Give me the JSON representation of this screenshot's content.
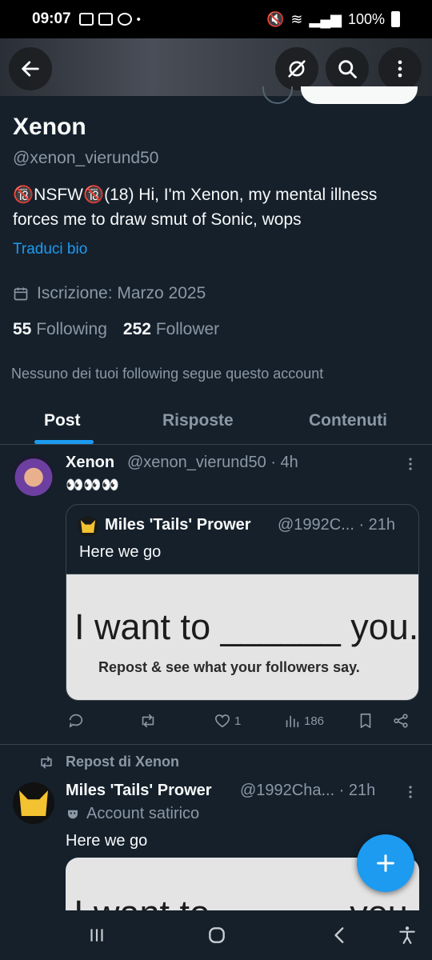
{
  "status_bar": {
    "time": "09:07",
    "battery": "100%"
  },
  "profile": {
    "name": "Xenon",
    "handle": "@xenon_vierund50",
    "bio": "🔞NSFW🔞(18) Hi, I'm Xenon, my mental illness forces me to draw smut of Sonic, wops",
    "translate_label": "Traduci bio",
    "joined": "Iscrizione: Marzo 2025",
    "following_count": "55",
    "following_label": "Following",
    "followers_count": "252",
    "followers_label": "Follower",
    "not_followed_note": "Nessuno dei tuoi following segue questo account"
  },
  "tabs": [
    {
      "label": "Post",
      "active": true
    },
    {
      "label": "Risposte",
      "active": false
    },
    {
      "label": "Contenuti",
      "active": false
    }
  ],
  "tweet1": {
    "name": "Xenon",
    "meta": "@xenon_vierund50 · 4h",
    "text": "👀👀👀",
    "quote": {
      "name": "Miles 'Tails' Prower",
      "meta": "@1992C... · 21h",
      "text": "Here we go",
      "image_main": "I want to ______ you.",
      "image_sub": "Repost & see what your followers say."
    },
    "actions": {
      "likes": "1",
      "views": "186"
    }
  },
  "tweet2": {
    "repost_label": "Repost di Xenon",
    "name": "Miles 'Tails' Prower",
    "meta": "@1992Cha... · 21h",
    "badge": "Account satirico",
    "text": "Here we go",
    "image_main": "I want to ______ you."
  },
  "colors": {
    "accent": "#1d9bf0",
    "background": "#15202b",
    "muted": "#8b98a5",
    "border": "#38444d"
  },
  "icons": {
    "back": "arrow-left-icon",
    "grok": "grok-icon",
    "search": "search-icon",
    "more": "more-vertical-icon",
    "calendar": "calendar-icon",
    "reply": "reply-icon",
    "repost": "repost-icon",
    "like": "heart-icon",
    "views": "views-icon",
    "bookmark": "bookmark-icon",
    "share": "share-icon",
    "compose": "plus-icon",
    "satire": "mask-icon"
  }
}
